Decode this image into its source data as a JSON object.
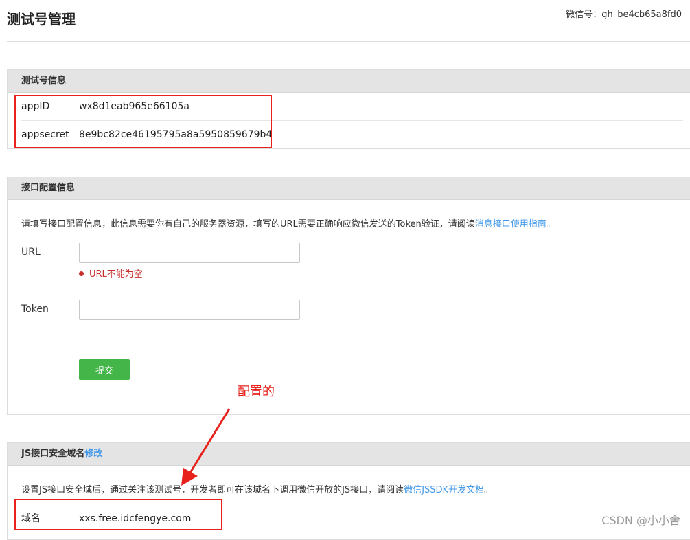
{
  "header": {
    "title": "测试号管理",
    "wechat_id_label": "微信号：",
    "wechat_id_value": "gh_be4cb65a8fd0"
  },
  "test_account": {
    "section_title": "测试号信息",
    "rows": [
      {
        "label": "appID",
        "value": "wx8d1eab965e66105a"
      },
      {
        "label": "appsecret",
        "value": "8e9bc82ce46195795a8a5950859679b4"
      }
    ]
  },
  "interface_config": {
    "section_title": "接口配置信息",
    "description": "请填写接口配置信息，此信息需要你有自己的服务器资源，填写的URL需要正确响应微信发送的Token验证，请阅读",
    "description_link": "消息接口使用指南",
    "description_end": "。",
    "url_label": "URL",
    "url_value": "",
    "url_error": "URL不能为空",
    "token_label": "Token",
    "token_value": "",
    "submit_label": "提交"
  },
  "js_domain": {
    "section_title": "JS接口安全域名",
    "edit_link": "修改",
    "description": "设置JS接口安全域后，通过关注该测试号，开发者即可在该域名下调用微信开放的JS接口，请阅读",
    "description_link": "微信JSSDK开发文档",
    "description_end": "。",
    "domain_label": "域名",
    "domain_value": "xxs.free.idcfengye.com"
  },
  "annotation": {
    "text": "配置的",
    "color": "#e8211d"
  },
  "watermark": "CSDN @小小舍",
  "colors": {
    "link": "#459ae9",
    "submit_button": "#44b549",
    "error": "#c9302c",
    "highlight_box": "#e8211d"
  }
}
